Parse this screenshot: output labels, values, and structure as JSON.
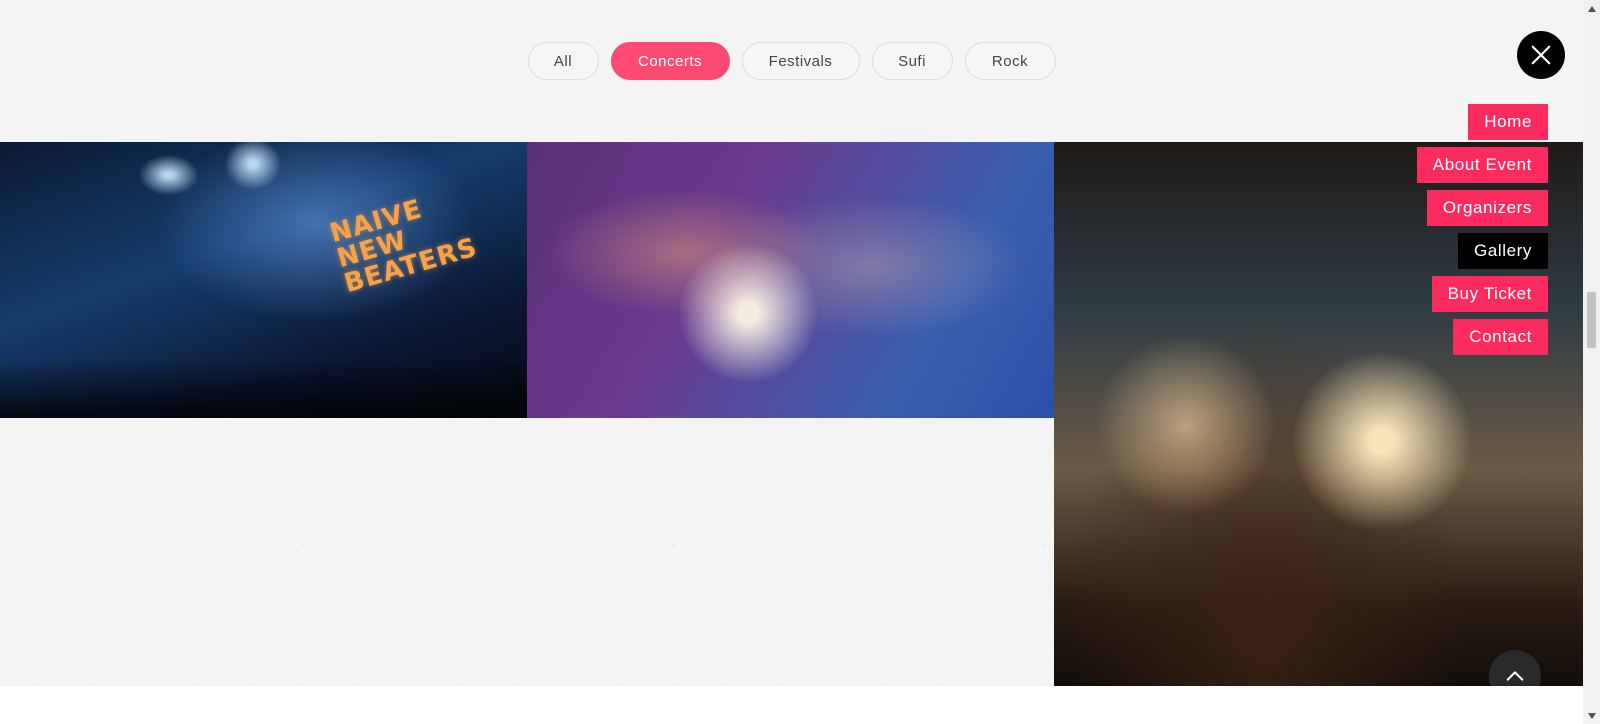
{
  "filters": [
    {
      "label": "All",
      "active": false
    },
    {
      "label": "Concerts",
      "active": true
    },
    {
      "label": "Festivals",
      "active": false
    },
    {
      "label": "Sufi",
      "active": false
    },
    {
      "label": "Rock",
      "active": false
    }
  ],
  "gallery": {
    "tile1": {
      "stage_sign": "NAIVE NEW BEATERS"
    }
  },
  "menu": {
    "items": [
      {
        "label": "Home"
      },
      {
        "label": "About Event"
      },
      {
        "label": "Organizers"
      },
      {
        "label": "Gallery"
      },
      {
        "label": "Buy Ticket"
      },
      {
        "label": "Contact"
      }
    ],
    "current": "Gallery"
  },
  "colors": {
    "accent": "#fb4b73",
    "nav_accent": "#fb2a5f",
    "nav_current": "#000000",
    "close_button": "#000000",
    "back_to_top": "#2a2a2a"
  },
  "icons": {
    "close": "close-icon",
    "back_to_top": "chevron-up-icon",
    "scroll_up": "triangle-up-icon",
    "scroll_down": "triangle-down-icon"
  }
}
